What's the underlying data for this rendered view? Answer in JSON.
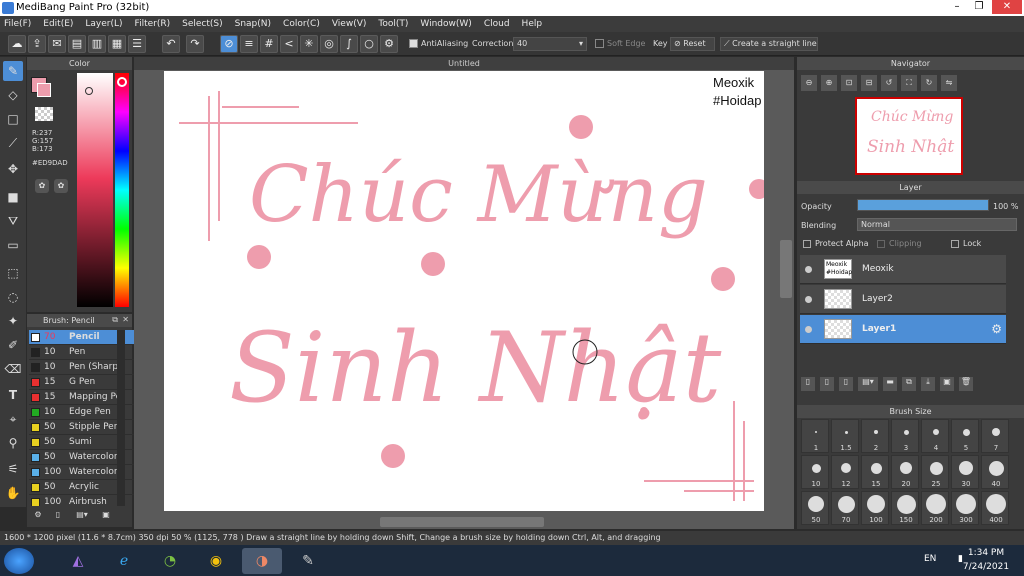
{
  "app": {
    "title": "MediBang Paint Pro (32bit)"
  },
  "menu": [
    "File(F)",
    "Edit(E)",
    "Layer(L)",
    "Filter(R)",
    "Select(S)",
    "Snap(N)",
    "Color(C)",
    "View(V)",
    "Tool(T)",
    "Window(W)",
    "Cloud",
    "Help"
  ],
  "toolbar": {
    "antialiasing_label": "AntiAliasing",
    "correction_label": "Correction",
    "correction_value": "40",
    "soft_edge_label": "Soft Edge",
    "key_label": "Key",
    "reset_label": "Reset",
    "straight_line_label": "Create a straight line"
  },
  "color_panel": {
    "title": "Color",
    "r": "R:237",
    "g": "G:157",
    "b": "B:173",
    "hex": "#ED9DAD",
    "primary_color": "#ED9DAD"
  },
  "brush_panel": {
    "title": "Brush: Pencil",
    "items": [
      {
        "size": "70",
        "name": "Pencil",
        "color": "#ffffff"
      },
      {
        "size": "10",
        "name": "Pen",
        "color": "#222222"
      },
      {
        "size": "10",
        "name": "Pen (Sharp",
        "color": "#222222"
      },
      {
        "size": "15",
        "name": "G Pen",
        "color": "#e83030"
      },
      {
        "size": "15",
        "name": "Mapping Pe",
        "color": "#e83030"
      },
      {
        "size": "10",
        "name": "Edge Pen",
        "color": "#22aa22"
      },
      {
        "size": "50",
        "name": "Stipple Pen",
        "color": "#e8d020"
      },
      {
        "size": "50",
        "name": "Sumi",
        "color": "#e8d020"
      },
      {
        "size": "50",
        "name": "Watercolor",
        "color": "#5ab0e8"
      },
      {
        "size": "100",
        "name": "Watercolor",
        "color": "#5ab0e8"
      },
      {
        "size": "50",
        "name": "Acrylic",
        "color": "#e8d020"
      },
      {
        "size": "100",
        "name": "Airbrush",
        "color": "#e8d020"
      }
    ]
  },
  "canvas": {
    "tab_title": "Untitled",
    "watermark_line1": "Meoxik",
    "watermark_line2": "#Hoidap",
    "text_line1": "Chúc Mừng",
    "text_line2": "Sinh Nhật",
    "ink_color": "#EE9DAD"
  },
  "navigator": {
    "title": "Navigator"
  },
  "layer_panel": {
    "title": "Layer",
    "opacity_label": "Opacity",
    "opacity_value": "100 %",
    "opacity_fraction": 1.0,
    "blending_label": "Blending",
    "blending_value": "Normal",
    "protect_alpha_label": "Protect Alpha",
    "clipping_label": "Clipping",
    "lock_label": "Lock",
    "layers": [
      {
        "name": "Meoxik",
        "thumb_line1": "Meoxik",
        "thumb_line2": "#Hoidap"
      },
      {
        "name": "Layer2"
      },
      {
        "name": "Layer1"
      }
    ]
  },
  "brush_size_panel": {
    "title": "Brush Size",
    "sizes": [
      "1",
      "1.5",
      "2",
      "3",
      "4",
      "5",
      "7",
      "10",
      "12",
      "15",
      "20",
      "25",
      "30",
      "40",
      "50",
      "70",
      "100",
      "150",
      "200",
      "300",
      "400"
    ]
  },
  "status": {
    "dimensions": "1600 * 1200 pixel",
    "physical": "(11.6 * 8.7cm)",
    "dpi": "350 dpi",
    "zoom": "50 %",
    "coords": "(1125, 778 )",
    "hint": "Draw a straight line by holding down Shift, Change a brush size by holding down Ctrl, Alt, and dragging"
  },
  "taskbar": {
    "lang": "EN",
    "time": "1:34 PM",
    "date": "7/24/2021"
  }
}
